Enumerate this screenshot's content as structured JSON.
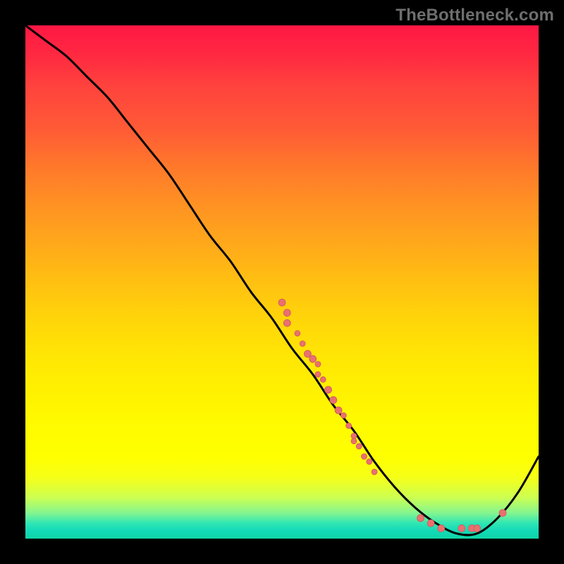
{
  "watermark": "TheBottleneck.com",
  "colors": {
    "page_bg": "#000000",
    "curve_stroke": "#000000",
    "dot_fill": "#e97070",
    "dot_stroke": "#d05a5a",
    "watermark": "#6e6e6e"
  },
  "chart_data": {
    "type": "line",
    "title": "",
    "xlabel": "",
    "ylabel": "",
    "xlim": [
      0,
      100
    ],
    "ylim": [
      0,
      100
    ],
    "series": [
      {
        "name": "bottleneck-curve",
        "x": [
          0,
          4,
          8,
          12,
          16,
          20,
          24,
          28,
          32,
          36,
          40,
          44,
          48,
          52,
          56,
          60,
          64,
          68,
          72,
          76,
          80,
          84,
          88,
          92,
          96,
          100
        ],
        "y": [
          100,
          97,
          94,
          90,
          86,
          81,
          76,
          71,
          65,
          59,
          54,
          48,
          43,
          37,
          32,
          26,
          21,
          15,
          10,
          6,
          3,
          1,
          1,
          4,
          9,
          16
        ]
      }
    ],
    "scatter": [
      {
        "name": "data-points",
        "points": [
          {
            "x": 50,
            "y": 46,
            "r": 5
          },
          {
            "x": 51,
            "y": 44,
            "r": 5
          },
          {
            "x": 51,
            "y": 42,
            "r": 5
          },
          {
            "x": 53,
            "y": 40,
            "r": 4
          },
          {
            "x": 54,
            "y": 38,
            "r": 4
          },
          {
            "x": 55,
            "y": 36,
            "r": 5
          },
          {
            "x": 56,
            "y": 35,
            "r": 5
          },
          {
            "x": 57,
            "y": 34,
            "r": 4
          },
          {
            "x": 57,
            "y": 32,
            "r": 4
          },
          {
            "x": 58,
            "y": 31,
            "r": 4
          },
          {
            "x": 59,
            "y": 29,
            "r": 5
          },
          {
            "x": 60,
            "y": 27,
            "r": 5
          },
          {
            "x": 61,
            "y": 25,
            "r": 5
          },
          {
            "x": 62,
            "y": 24,
            "r": 4
          },
          {
            "x": 63,
            "y": 22,
            "r": 4
          },
          {
            "x": 64,
            "y": 20,
            "r": 4
          },
          {
            "x": 64,
            "y": 19,
            "r": 4
          },
          {
            "x": 65,
            "y": 18,
            "r": 4
          },
          {
            "x": 66,
            "y": 16,
            "r": 4
          },
          {
            "x": 67,
            "y": 15,
            "r": 4
          },
          {
            "x": 68,
            "y": 13,
            "r": 4
          },
          {
            "x": 77,
            "y": 4,
            "r": 5
          },
          {
            "x": 79,
            "y": 3,
            "r": 5
          },
          {
            "x": 81,
            "y": 2,
            "r": 5
          },
          {
            "x": 85,
            "y": 2,
            "r": 5
          },
          {
            "x": 87,
            "y": 2,
            "r": 5
          },
          {
            "x": 88,
            "y": 2,
            "r": 5
          },
          {
            "x": 93,
            "y": 5,
            "r": 5
          }
        ]
      }
    ]
  }
}
